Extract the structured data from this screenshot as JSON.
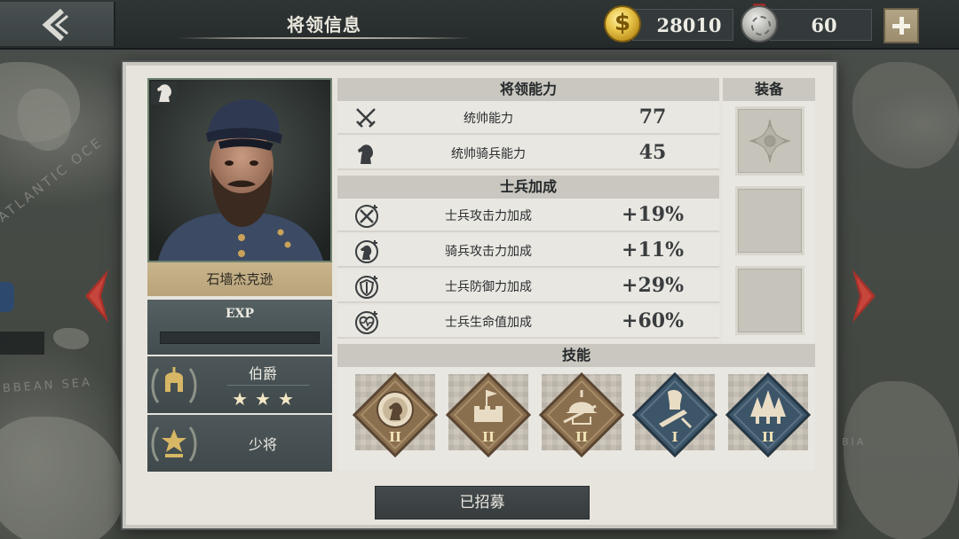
{
  "header": {
    "title": "将领信息",
    "gold": "28010",
    "gold_symbol": "$",
    "medals": "60"
  },
  "map": {
    "labels": [
      "ATLANTIC OCE",
      "IBBEAN SEA",
      "BIA"
    ]
  },
  "general": {
    "name": "石墙杰克逊",
    "exp_label": "EXP",
    "exp_progress": 0,
    "rank1": {
      "title": "伯爵",
      "stars": "★★★"
    },
    "rank2": {
      "title": "少将"
    }
  },
  "abilities": {
    "header": "将领能力",
    "rows": [
      {
        "icon": "crossed-swords-icon",
        "label": "统帅能力",
        "value": "77"
      },
      {
        "icon": "horse-head-icon",
        "label": "统帅骑兵能力",
        "value": "45"
      }
    ]
  },
  "bonus": {
    "header": "士兵加成",
    "rows": [
      {
        "icon": "attack-bonus-icon",
        "label": "士兵攻击力加成",
        "value": "+19%"
      },
      {
        "icon": "cavalry-bonus-icon",
        "label": "骑兵攻击力加成",
        "value": "+11%"
      },
      {
        "icon": "defense-bonus-icon",
        "label": "士兵防御力加成",
        "value": "+29%"
      },
      {
        "icon": "health-bonus-icon",
        "label": "士兵生命值加成",
        "value": "+60%"
      }
    ]
  },
  "equipment": {
    "header": "装备",
    "slots": [
      "order-star-icon",
      "empty",
      "empty"
    ]
  },
  "skills": {
    "header": "技能",
    "items": [
      {
        "icon": "horse-medallion-icon",
        "level": "II",
        "color": "#8a6f4e"
      },
      {
        "icon": "fortress-flag-icon",
        "level": "II",
        "color": "#8a6f4e"
      },
      {
        "icon": "soldier-helmet-icon",
        "level": "II",
        "color": "#8a6f4e"
      },
      {
        "icon": "artillery-shell-icon",
        "level": "I",
        "color": "#3d5568"
      },
      {
        "icon": "forest-trees-icon",
        "level": "II",
        "color": "#3d5568"
      }
    ]
  },
  "recruit_button": "已招募",
  "colors": {
    "panel": "#e6e4dd",
    "header_bar": "#c9c7bf",
    "name_plate": "#c9b58d",
    "dark_bar": "#2a3031",
    "arrow_red": "#a9322a"
  }
}
